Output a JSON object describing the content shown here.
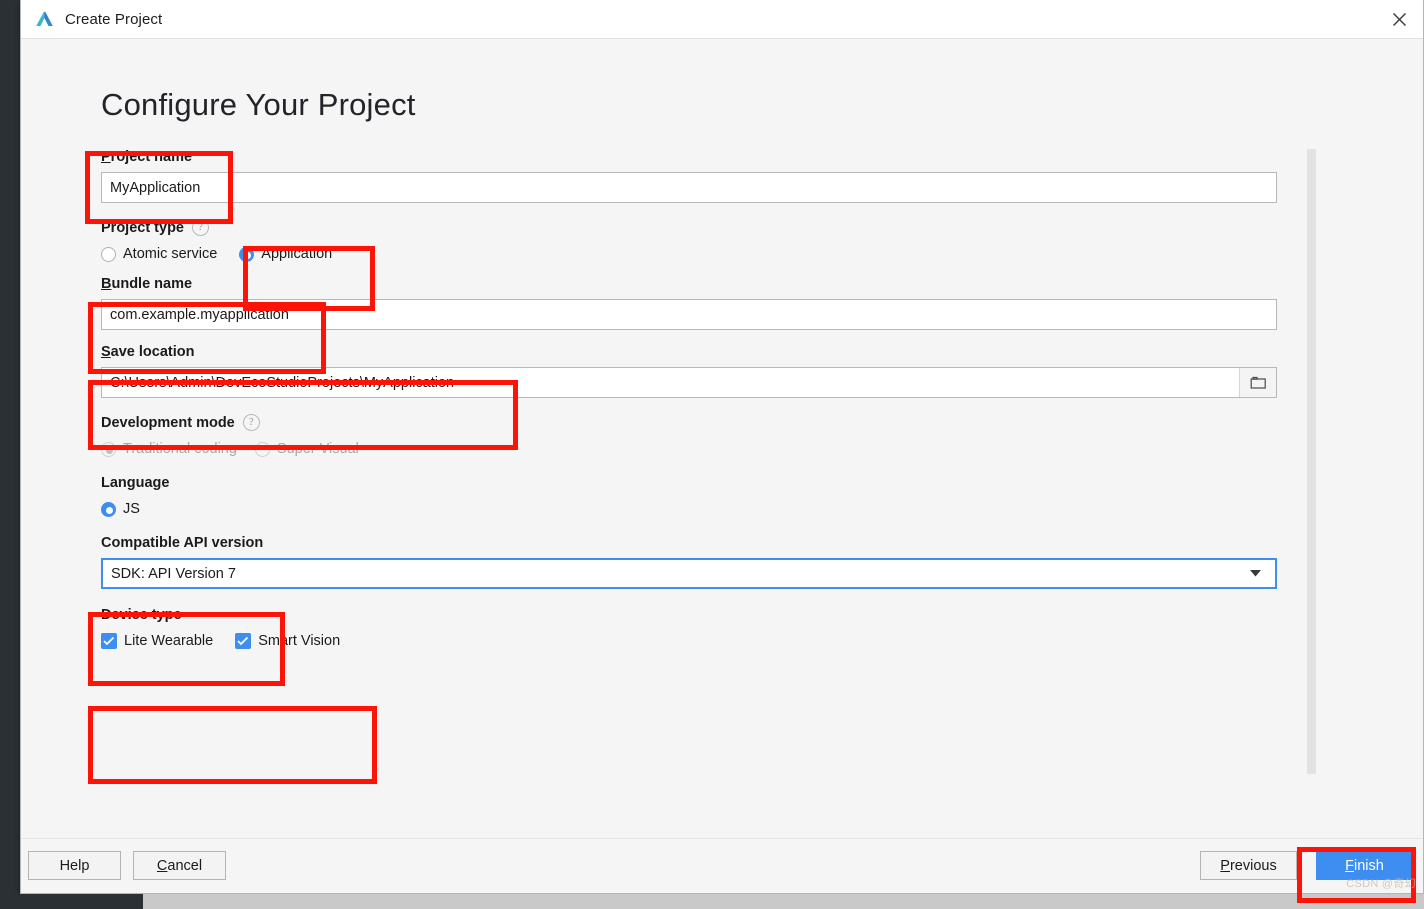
{
  "window": {
    "title": "Create Project",
    "logo_icon": "deveco-logo-icon",
    "close_icon": "close-icon"
  },
  "page": {
    "heading": "Configure Your Project"
  },
  "fields": {
    "project_name": {
      "label": "Project name",
      "mnemonic": "P",
      "value": "MyApplication"
    },
    "project_type": {
      "label": "Project type",
      "help_icon": "question-mark-icon",
      "options": [
        {
          "label": "Atomic service",
          "checked": false
        },
        {
          "label": "Application",
          "checked": true
        }
      ]
    },
    "bundle_name": {
      "label": "Bundle name",
      "mnemonic": "B",
      "value": "com.example.myapplication"
    },
    "save_location": {
      "label": "Save location",
      "mnemonic": "S",
      "value": "C:\\Users\\Admin\\DevEcoStudioProjects\\MyApplication",
      "browse_icon": "folder-icon"
    },
    "development_mode": {
      "label": "Development mode",
      "help_icon": "question-mark-icon",
      "disabled": true,
      "options": [
        {
          "label": "Traditional coding",
          "checked": true
        },
        {
          "label": "Super Visual",
          "checked": false
        }
      ]
    },
    "language": {
      "label": "Language",
      "options": [
        {
          "label": "JS",
          "checked": true
        }
      ]
    },
    "compatible_api_version": {
      "label": "Compatible API version",
      "value": "SDK: API Version 7",
      "dropdown_icon": "chevron-down-icon",
      "focused": true
    },
    "device_type": {
      "label": "Device type",
      "options": [
        {
          "label": "Lite Wearable",
          "checked": true
        },
        {
          "label": "Smart Vision",
          "checked": true
        }
      ]
    }
  },
  "footer": {
    "help_label": "Help",
    "cancel_label": "Cancel",
    "cancel_mnemonic": "C",
    "previous_label": "Previous",
    "previous_mnemonic": "P",
    "finish_label": "Finish",
    "finish_mnemonic": "F"
  },
  "watermark": "CSDN @奇幻",
  "colors": {
    "accent": "#3d8ef0",
    "annotation": "#fc1408",
    "dialog_bg": "#f5f5f5",
    "field_bg": "#ffffff",
    "text": "#1b1b1b",
    "disabled_text": "#a6a6a6"
  }
}
